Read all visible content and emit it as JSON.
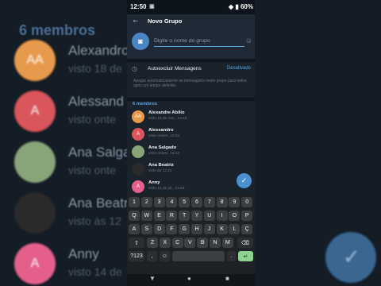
{
  "background": {
    "title": "6 membros",
    "rows": [
      {
        "initials": "AA",
        "name": "Alexandro",
        "sub": "visto 18 de",
        "color": "#e79a4c"
      },
      {
        "initials": "A",
        "name": "Alessand",
        "sub": "visto onte",
        "color": "#d8565c"
      },
      {
        "initials": "",
        "name": "Ana Salga",
        "sub": "visto onte",
        "color": "#8aa47a"
      },
      {
        "initials": "",
        "name": "Ana Beatr",
        "sub": "visto às 12",
        "color": "#2a2a2a"
      },
      {
        "initials": "A",
        "name": "Anny",
        "sub": "visto 14 de",
        "color": "#e4608a"
      }
    ]
  },
  "status_bar": {
    "time": "12:50",
    "battery": "60%"
  },
  "app_bar": {
    "title": "Novo Grupo"
  },
  "group_name": {
    "placeholder": "Digite o nome do grupo"
  },
  "auto_delete": {
    "label": "Autoexcluir Mensagens",
    "value": "Desativado",
    "description": "Apagar automaticamente as mensagens neste grupo para todos após um tempo definido."
  },
  "members": {
    "header": "6 membros",
    "list": [
      {
        "initials": "AA",
        "name": "Alexandre Abílio",
        "sub": "visto 18 de mar., 14:18",
        "color": "#e79a4c"
      },
      {
        "initials": "A",
        "name": "Alessandro",
        "sub": "visto ontem, 22:44",
        "color": "#d8565c"
      },
      {
        "initials": "",
        "name": "Ana Salgado",
        "sub": "visto ontem, 15:12",
        "color": "#8aa47a"
      },
      {
        "initials": "",
        "name": "Ana Beatriz",
        "sub": "visto às 12:21",
        "color": "#2a2a2a"
      },
      {
        "initials": "A",
        "name": "Anny",
        "sub": "visto 14 de jul., 21:53",
        "color": "#e4608a"
      }
    ]
  },
  "keyboard": {
    "row1": [
      "1",
      "2",
      "3",
      "4",
      "5",
      "6",
      "7",
      "8",
      "9",
      "0"
    ],
    "row2": [
      "Q",
      "W",
      "E",
      "R",
      "T",
      "Y",
      "U",
      "I",
      "O",
      "P"
    ],
    "row3": [
      "A",
      "S",
      "D",
      "F",
      "G",
      "H",
      "J",
      "K",
      "L",
      "Ç"
    ],
    "row4": [
      "Z",
      "X",
      "C",
      "V",
      "B",
      "N",
      "M"
    ],
    "shift": "⇧",
    "backspace": "⌫",
    "symbols": "?123",
    "comma": ",",
    "emoji": "☺",
    "period": ".",
    "enter": "↵"
  },
  "nav": {
    "back": "▼",
    "home": "●",
    "recents": "■"
  }
}
